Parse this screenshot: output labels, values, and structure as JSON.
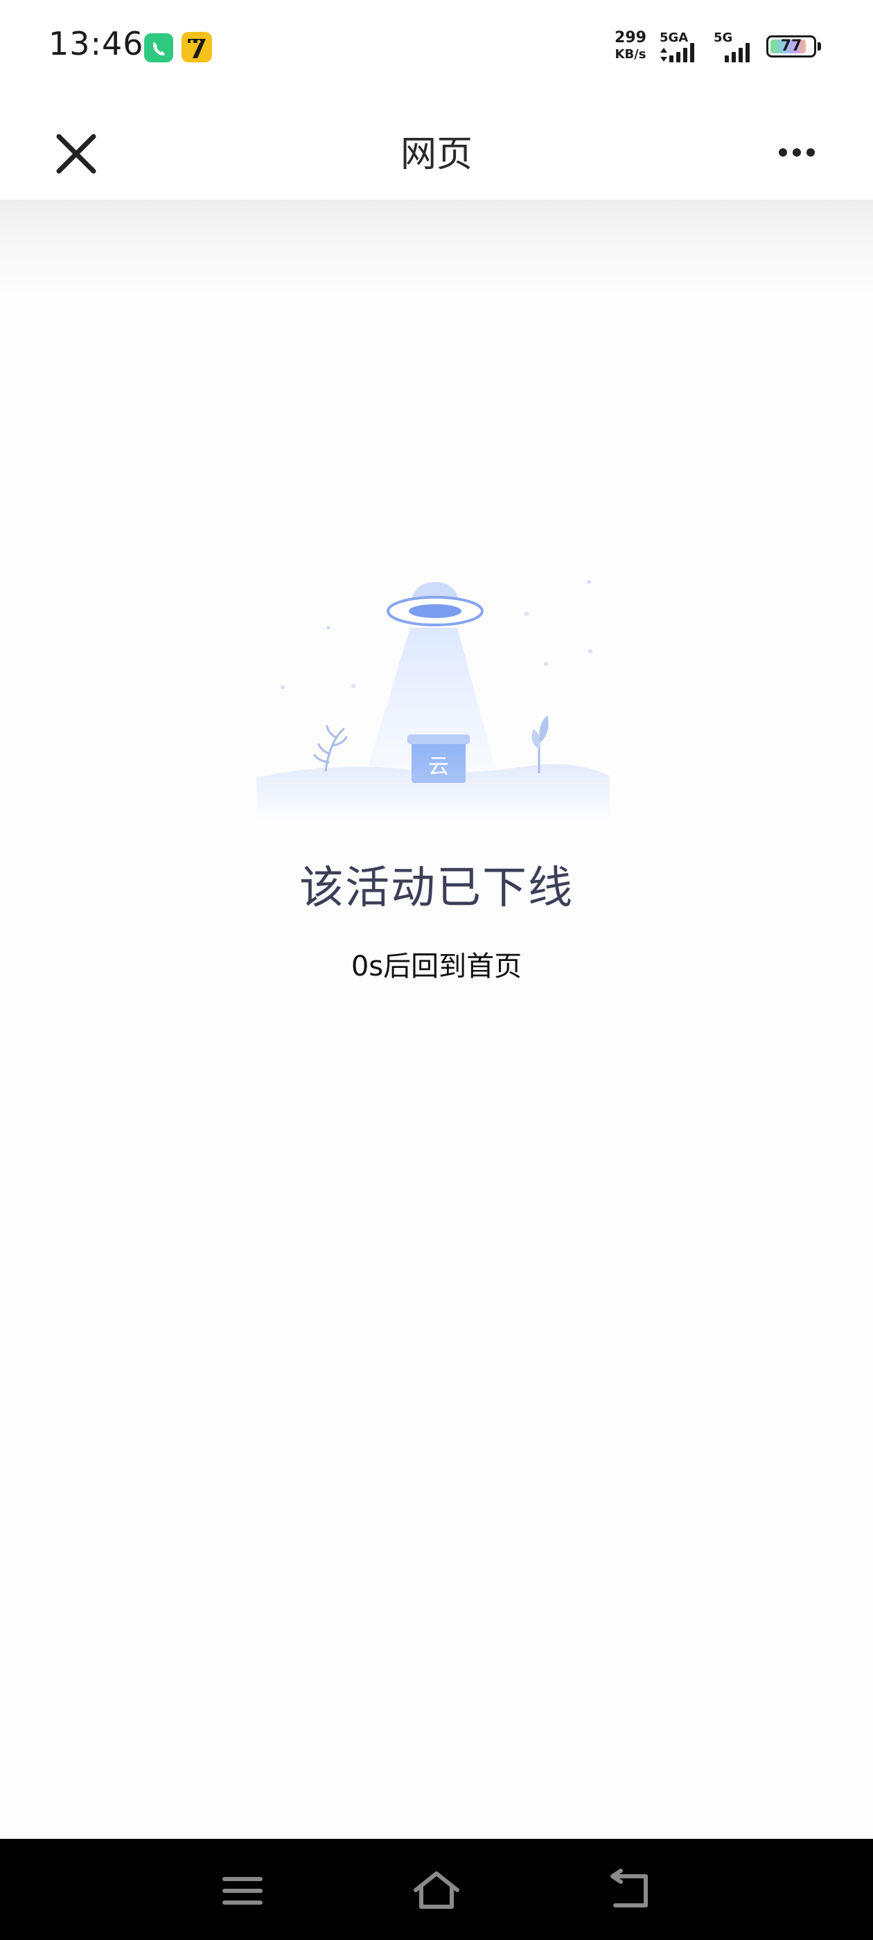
{
  "status_bar": {
    "time": "13:46",
    "net_speed_value": "299",
    "net_speed_unit": "KB/s",
    "signal1_label": "5GA",
    "signal2_label": "5G",
    "battery": "77",
    "apps": [
      "phone-app-icon",
      "seven-cat-app-icon"
    ]
  },
  "title_bar": {
    "title": "网页",
    "close_icon": "close-icon",
    "more_icon": "more-dots-icon"
  },
  "content": {
    "illustration_icon": "ufo-beam-box-illustration",
    "box_label": "云",
    "message": "该活动已下线",
    "countdown": "0s后回到首页"
  },
  "nav_bar": {
    "menu_icon": "menu-icon",
    "home_icon": "home-icon",
    "back_icon": "back-icon"
  },
  "colors": {
    "accent_blue": "#5e8ff0",
    "message_text": "#3d3f58"
  }
}
